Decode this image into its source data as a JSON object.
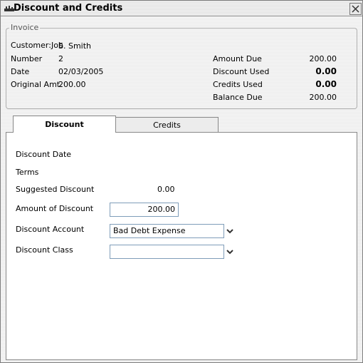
{
  "window": {
    "title": "Discount and Credits"
  },
  "invoice": {
    "legend": "Invoice",
    "customer_job_label": "Customer:Job",
    "customer_job_value": "S. Smith",
    "number_label": "Number",
    "number_value": "2",
    "date_label": "Date",
    "date_value": "02/03/2005",
    "original_amt_label": "Original Amt.",
    "original_amt_value": "200.00",
    "amount_due_label": "Amount Due",
    "amount_due_value": "200.00",
    "discount_used_label": "Discount Used",
    "discount_used_value": "0.00",
    "credits_used_label": "Credits Used",
    "credits_used_value": "0.00",
    "balance_due_label": "Balance Due",
    "balance_due_value": "200.00"
  },
  "tabs": [
    {
      "label": "Discount",
      "active": true
    },
    {
      "label": "Credits",
      "active": false
    }
  ],
  "discount": {
    "discount_date_label": "Discount Date",
    "terms_label": "Terms",
    "suggested_discount_label": "Suggested Discount",
    "suggested_discount_value": "0.00",
    "amount_of_discount_label": "Amount of Discount",
    "amount_of_discount_value": "200.00",
    "discount_account_label": "Discount Account",
    "discount_account_value": "Bad Debt Expense",
    "discount_class_label": "Discount Class",
    "discount_class_value": ""
  },
  "icons": {
    "window_icon": "app-icon",
    "close": "close-icon",
    "dropdown": "chevron-down-icon"
  }
}
